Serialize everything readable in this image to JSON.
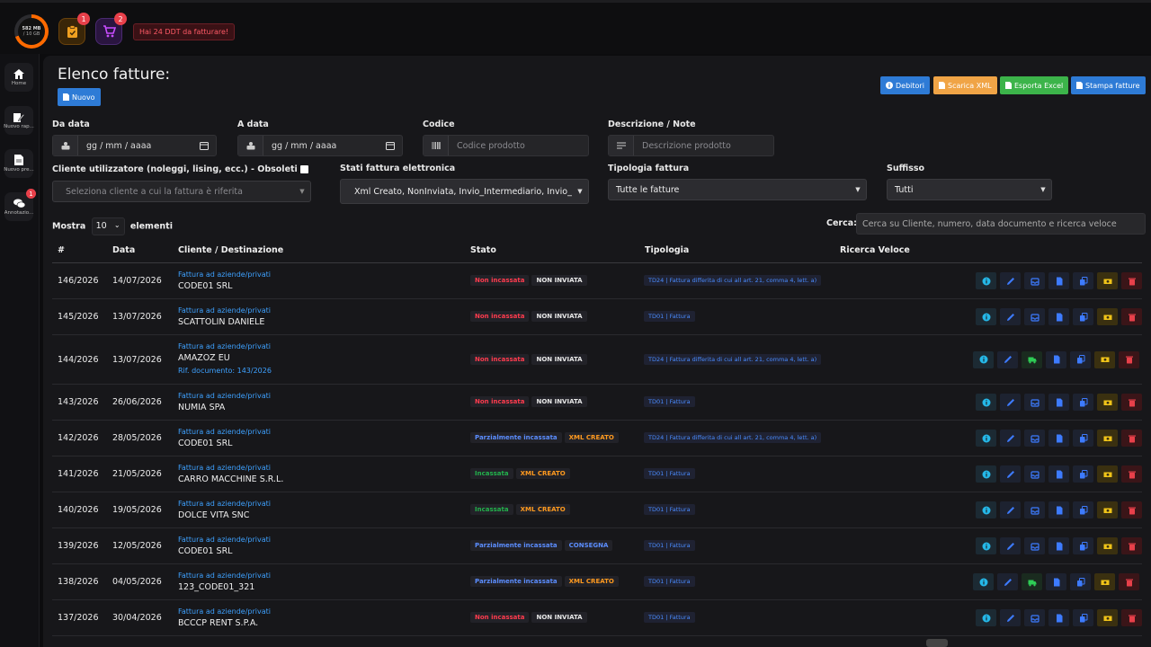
{
  "topbar": {
    "storage_used": "582 MB",
    "storage_total": "/ 10 GB",
    "storage_fraction": 0.7,
    "clipboard_badge": "1",
    "cart_badge": "2",
    "alert_text": "Hai 24 DDT da fatturare!"
  },
  "sidebar": {
    "items": [
      {
        "label": "Home",
        "icon": "home-icon"
      },
      {
        "label": "Nuovo rap...",
        "icon": "edit-report-icon"
      },
      {
        "label": "Nuovo pre...",
        "icon": "document-icon"
      },
      {
        "label": "Annotazio...",
        "icon": "chat-icon",
        "badge": "1"
      }
    ]
  },
  "page": {
    "title": "Elenco fatture:",
    "new_label": "Nuovo"
  },
  "toolbar": {
    "debitori": "Debitori",
    "scarica_xml": "Scarica XML",
    "esporta_excel": "Esporta Excel",
    "stampa_fatture": "Stampa fatture"
  },
  "filters": {
    "da_data": {
      "label": "Da data",
      "placeholder": "gg / mm / aaaa"
    },
    "a_data": {
      "label": "A data",
      "placeholder": "gg / mm / aaaa"
    },
    "codice": {
      "label": "Codice",
      "placeholder": "Codice prodotto"
    },
    "descrizione": {
      "label": "Descrizione / Note",
      "placeholder": "Descrizione prodotto"
    },
    "cliente": {
      "label": "Cliente utilizzatore (noleggi, lising, ecc.) - Obsoleti",
      "placeholder": "Seleziona cliente a cui la fattura è riferita"
    },
    "stati": {
      "label": "Stati fattura elettronica",
      "value": "Xml Creato, NonInviata, Invio_Intermediario, Invio_S"
    },
    "tipologia": {
      "label": "Tipologia fattura",
      "value": "Tutte le fatture"
    },
    "suffisso": {
      "label": "Suffisso",
      "value": "Tutti"
    }
  },
  "table_controls": {
    "show_prefix": "Mostra",
    "show_value": "10",
    "show_suffix": "elementi",
    "search_label": "Cerca:",
    "search_placeholder": "Cerca su Cliente, numero, data documento e ricerca veloce"
  },
  "columns": [
    "#",
    "Data",
    "Cliente / Destinazione",
    "Stato",
    "Tipologia",
    "Ricerca Veloce"
  ],
  "rows": [
    {
      "num": "146/2026",
      "date": "14/07/2026",
      "type": "Fattura ad aziende/privati",
      "name": "CODE01 SRL",
      "ref": "",
      "pay": "Non incassata",
      "xml": "NON INVIATA",
      "tip": "TD24 | Fattura differita di cui all art. 21, comma 4, lett. a)",
      "alt": false
    },
    {
      "num": "145/2026",
      "date": "13/07/2026",
      "type": "Fattura ad aziende/privati",
      "name": "SCATTOLIN DANIELE",
      "ref": "",
      "pay": "Non incassata",
      "xml": "NON INVIATA",
      "tip": "TD01 | Fattura",
      "alt": false
    },
    {
      "num": "144/2026",
      "date": "13/07/2026",
      "type": "Fattura ad aziende/privati",
      "name": "AMAZOZ EU",
      "ref": "Rif. documento: 143/2026",
      "pay": "Non incassata",
      "xml": "NON INVIATA",
      "tip": "TD24 | Fattura differita di cui all art. 21, comma 4, lett. a)",
      "alt": true
    },
    {
      "num": "143/2026",
      "date": "26/06/2026",
      "type": "Fattura ad aziende/privati",
      "name": "NUMIA SPA",
      "ref": "",
      "pay": "Non incassata",
      "xml": "NON INVIATA",
      "tip": "TD01 | Fattura",
      "alt": false
    },
    {
      "num": "142/2026",
      "date": "28/05/2026",
      "type": "Fattura ad aziende/privati",
      "name": "CODE01 SRL",
      "ref": "",
      "pay": "Parzialmente incassata",
      "xml": "XML CREATO",
      "tip": "TD24 | Fattura differita di cui all art. 21, comma 4, lett. a)",
      "alt": false
    },
    {
      "num": "141/2026",
      "date": "21/05/2026",
      "type": "Fattura ad aziende/privati",
      "name": "CARRO MACCHINE S.R.L.",
      "ref": "",
      "pay": "Incassata",
      "xml": "XML CREATO",
      "tip": "TD01 | Fattura",
      "alt": false
    },
    {
      "num": "140/2026",
      "date": "19/05/2026",
      "type": "Fattura ad aziende/privati",
      "name": "DOLCE VITA SNC",
      "ref": "",
      "pay": "Incassata",
      "xml": "XML CREATO",
      "tip": "TD01 | Fattura",
      "alt": false
    },
    {
      "num": "139/2026",
      "date": "12/05/2026",
      "type": "Fattura ad aziende/privati",
      "name": "CODE01 SRL",
      "ref": "",
      "pay": "Parzialmente incassata",
      "xml": "CONSEGNA",
      "tip": "TD01 | Fattura",
      "alt": false
    },
    {
      "num": "138/2026",
      "date": "04/05/2026",
      "type": "Fattura ad aziende/privati",
      "name": "123_CODE01_321",
      "ref": "",
      "pay": "Parzialmente incassata",
      "xml": "XML CREATO",
      "tip": "TD01 | Fattura",
      "alt": true
    },
    {
      "num": "137/2026",
      "date": "30/04/2026",
      "type": "Fattura ad aziende/privati",
      "name": "BCCCP RENT S.P.A.",
      "ref": "",
      "pay": "Non incassata",
      "xml": "NON INVIATA",
      "tip": "TD01 | Fattura",
      "alt": false
    }
  ],
  "colors": {
    "pay": {
      "Non incassata": "#ff3b4e",
      "Parzialmente incassata": "#5b8dff",
      "Incassata": "#22b24c"
    },
    "xml": {
      "NON INVIATA": "#e8e8e8",
      "XML CREATO": "#ff9a1f",
      "CONSEGNA": "#5b8dff"
    }
  }
}
